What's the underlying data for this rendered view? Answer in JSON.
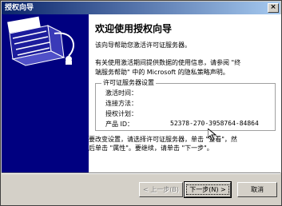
{
  "window": {
    "title": "授权向导"
  },
  "content": {
    "heading": "欢迎使用授权向导",
    "intro": "该向导帮助您激活许可证服务器。",
    "info_line1": "有关使用激活期间提供数据的使用信息，请参阅 \"终",
    "info_line2": "端服务帮助\" 中的 Microsoft 的隐私策略声明。",
    "group_title": "许可证服务器设置",
    "fields": [
      {
        "label": "激活时间：",
        "value": ""
      },
      {
        "label": "连接方法：",
        "value": ""
      },
      {
        "label": "授权计划：",
        "value": ""
      },
      {
        "label": "产品 ID：",
        "value": "52378-270-3958764-84864"
      }
    ],
    "footer_line1": "要改变设置，请选择许可证服务器，单击 \"查看\"，然",
    "footer_line2": "后单击 \"属性\"。要继续，请单击 \"下一步\"。"
  },
  "buttons": {
    "back": "< 上一步(B)",
    "next": "下一步(N) >",
    "cancel": "取消"
  },
  "icons": {
    "side": "wizard-illustration-icon",
    "close": "close-icon",
    "cursor": "mouse-cursor-icon"
  },
  "colors": {
    "side_panel": "#000080",
    "titlebar": "#0a246a",
    "face": "#d4d0c8"
  }
}
